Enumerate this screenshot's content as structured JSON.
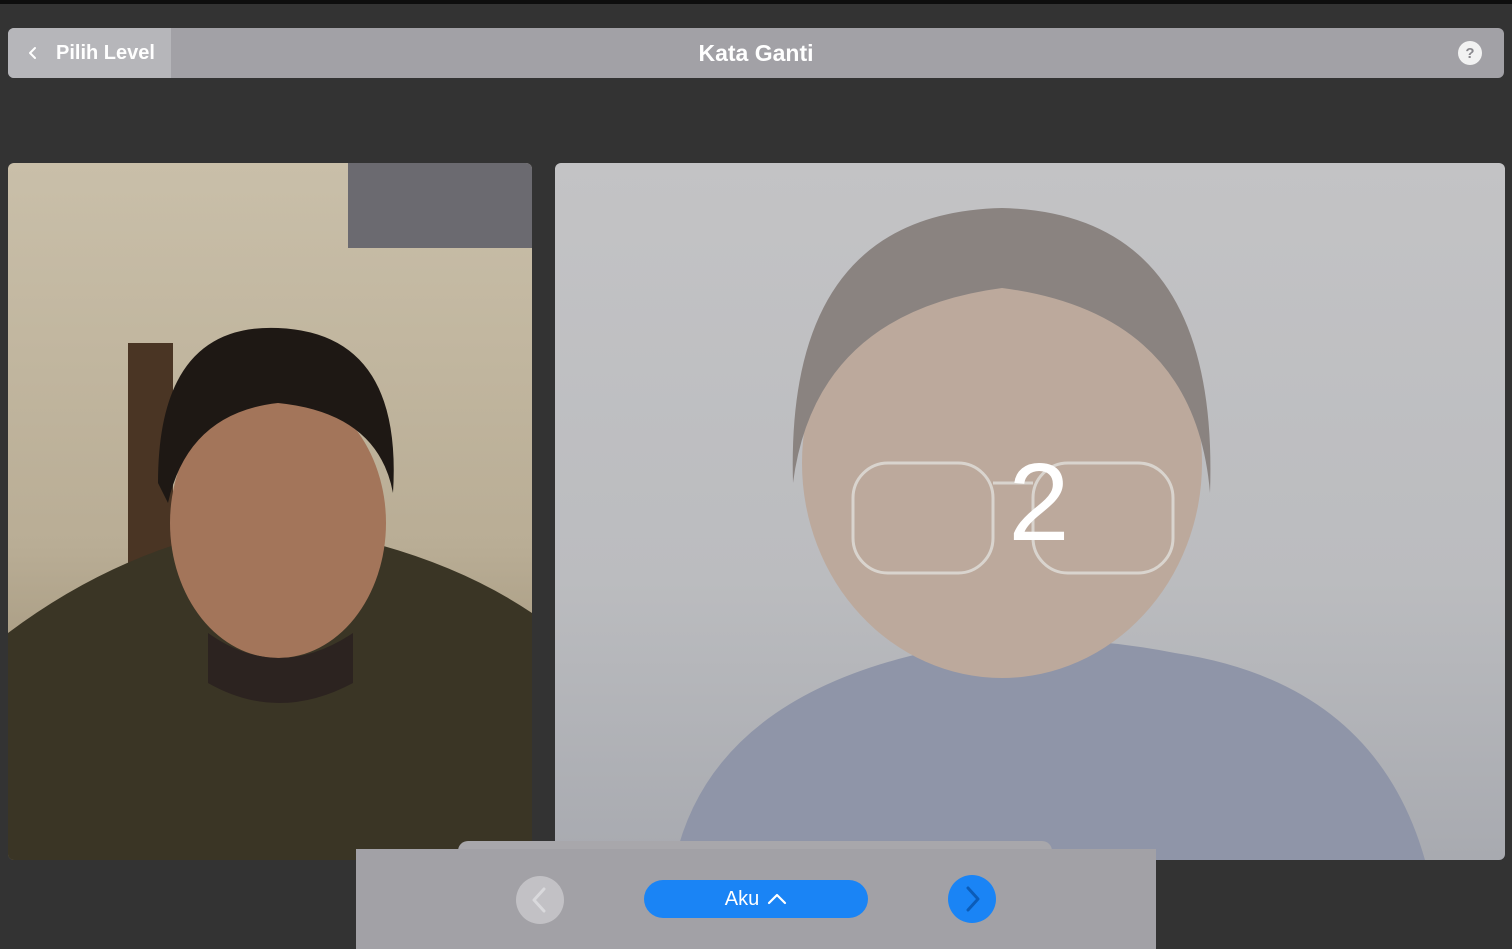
{
  "header": {
    "back_label": "Pilih Level",
    "title": "Kata Ganti",
    "help_label": "?"
  },
  "videos": {
    "left": {
      "icon": "camera-feed"
    },
    "right": {
      "icon": "camera-feed"
    }
  },
  "countdown": {
    "value": "2"
  },
  "controls": {
    "word_label": "Aku",
    "prev_icon": "chevron-left-icon",
    "next_icon": "chevron-right-icon",
    "accent_color": "#1a84f5"
  }
}
